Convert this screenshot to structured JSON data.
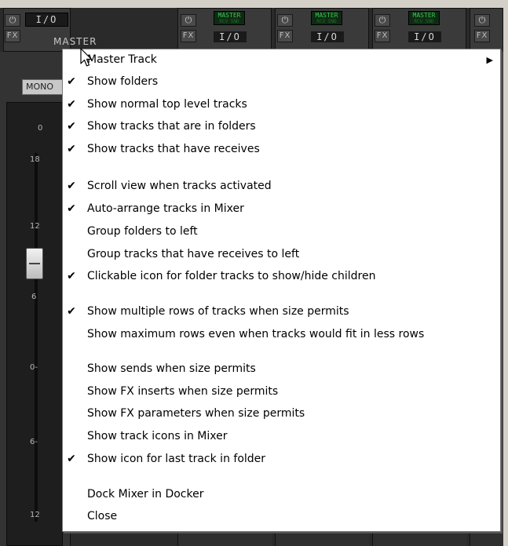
{
  "mixer": {
    "master": {
      "power_icon": "power-icon",
      "fx_label": "FX",
      "io_label": "I/O",
      "name": "MASTER",
      "mono_label": "MONO",
      "db_marks": [
        "0",
        "18",
        "12",
        "6",
        "0-",
        "6-",
        "12"
      ]
    },
    "tracks": [
      {
        "fx_label": "FX",
        "badge": "MASTER",
        "badge_sub": "RCV SND",
        "io_label": "I/O"
      },
      {
        "fx_label": "FX",
        "badge": "MASTER",
        "badge_sub": "RCV SND",
        "io_label": "I/O"
      },
      {
        "fx_label": "FX",
        "badge": "MASTER",
        "badge_sub": "RCV SND",
        "io_label": "I/O"
      },
      {
        "fx_label": "FX"
      }
    ]
  },
  "menu": {
    "items": [
      {
        "label": "Master Track",
        "checked": false,
        "submenu": true
      },
      {
        "label": "Show folders",
        "checked": true
      },
      {
        "label": "Show normal top level tracks",
        "checked": true
      },
      {
        "label": "Show tracks that are in folders",
        "checked": true
      },
      {
        "label": "Show tracks that have receives",
        "checked": true
      },
      {
        "label": "Scroll view when tracks activated",
        "checked": true
      },
      {
        "label": "Auto-arrange tracks in Mixer",
        "checked": true
      },
      {
        "label": "Group folders to left",
        "checked": false
      },
      {
        "label": "Group tracks that have receives to left",
        "checked": false
      },
      {
        "label": "Clickable icon for folder tracks to show/hide children",
        "checked": true
      },
      {
        "label": "Show multiple rows of tracks when size permits",
        "checked": true
      },
      {
        "label": "Show maximum rows even when tracks would fit in less rows",
        "checked": false
      },
      {
        "label": "Show sends when size permits",
        "checked": false
      },
      {
        "label": "Show FX inserts when size permits",
        "checked": false
      },
      {
        "label": "Show FX parameters when size permits",
        "checked": false
      },
      {
        "label": "Show track icons in Mixer",
        "checked": false
      },
      {
        "label": "Show icon for last track in folder",
        "checked": true
      },
      {
        "label": "Dock Mixer in Docker",
        "checked": false
      },
      {
        "label": "Close",
        "checked": false
      }
    ],
    "check_glyph": "✔",
    "submenu_glyph": "▶"
  },
  "colors": {
    "menu_bg": "#ffffff",
    "mixer_bg": "#2a2a2a",
    "badge_green": "#39c84e"
  }
}
